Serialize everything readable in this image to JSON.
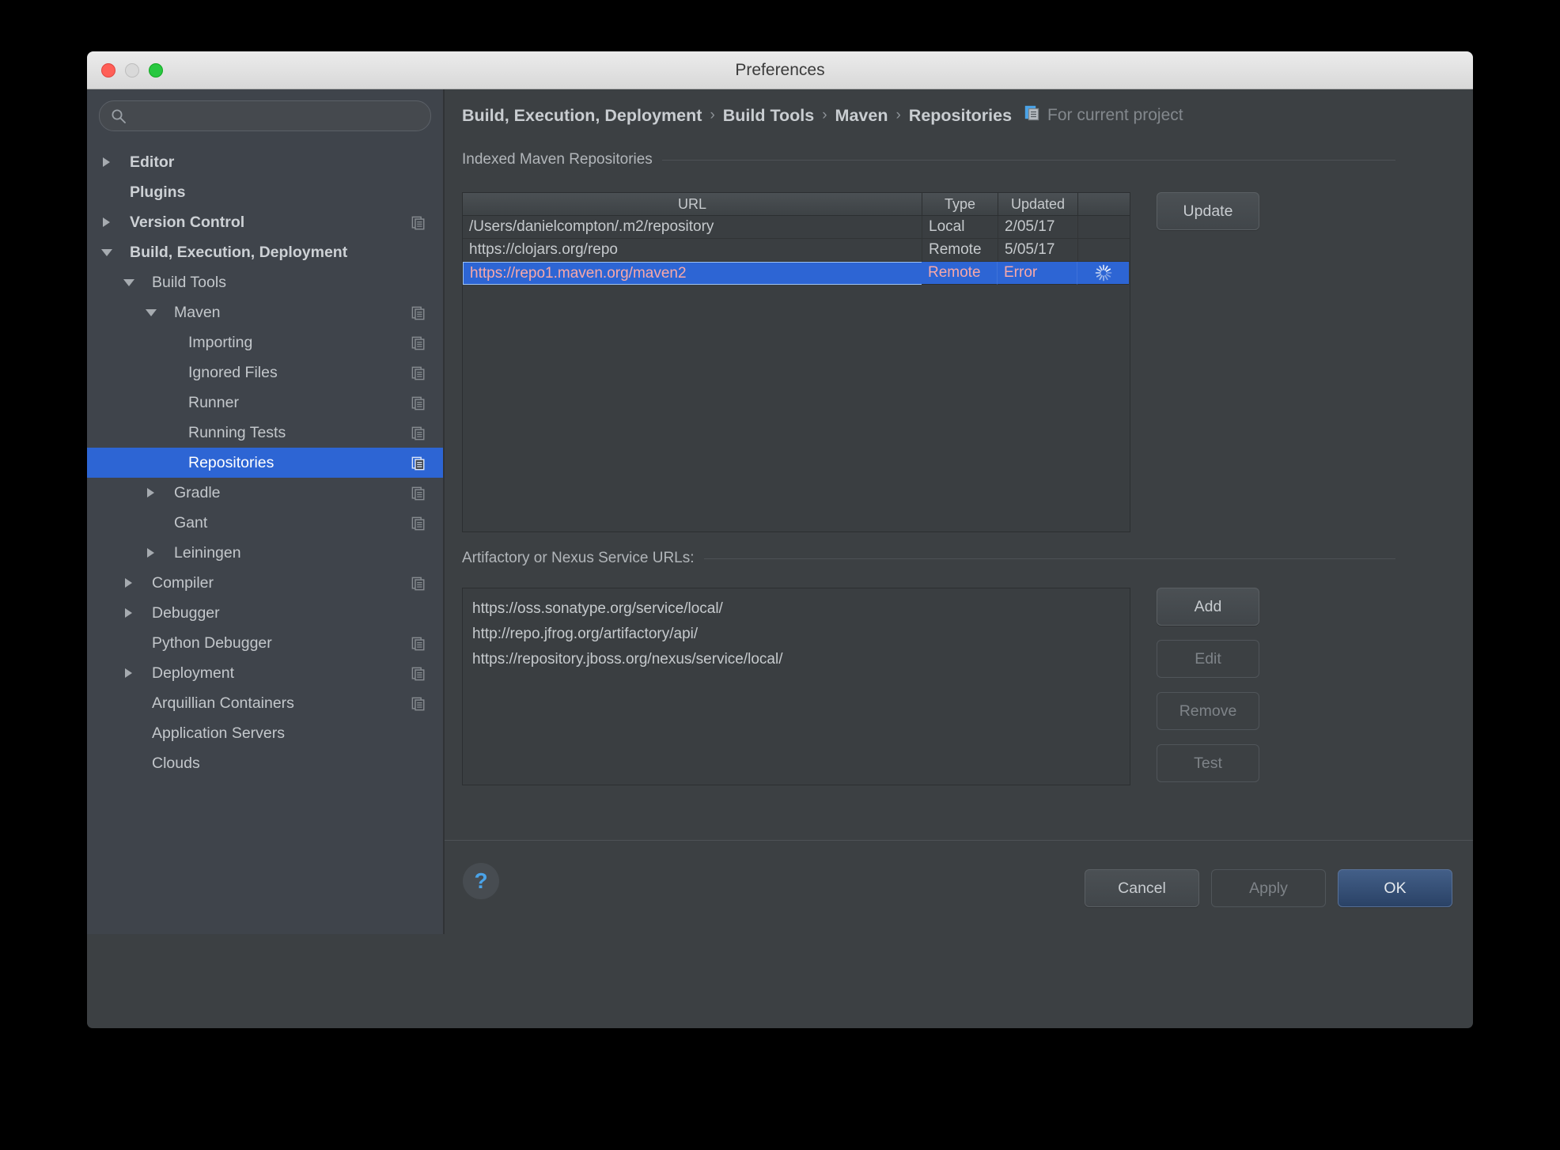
{
  "window": {
    "title": "Preferences",
    "traffic_lights": [
      "close-button",
      "minimize-button",
      "zoom-button"
    ]
  },
  "sidebar": {
    "search": {
      "value": "",
      "placeholder": ""
    },
    "items": [
      {
        "label": "Editor",
        "level": 0,
        "arrow": "right",
        "bold": true,
        "copy": false,
        "selected": false
      },
      {
        "label": "Plugins",
        "level": 0,
        "arrow": "none",
        "bold": true,
        "copy": false,
        "selected": false
      },
      {
        "label": "Version Control",
        "level": 0,
        "arrow": "right",
        "bold": true,
        "copy": true,
        "selected": false
      },
      {
        "label": "Build, Execution, Deployment",
        "level": 0,
        "arrow": "down",
        "bold": true,
        "copy": false,
        "selected": false
      },
      {
        "label": "Build Tools",
        "level": 1,
        "arrow": "down",
        "bold": false,
        "copy": false,
        "selected": false
      },
      {
        "label": "Maven",
        "level": 2,
        "arrow": "down",
        "bold": false,
        "copy": true,
        "selected": false
      },
      {
        "label": "Importing",
        "level": 3,
        "arrow": "none",
        "bold": false,
        "copy": true,
        "selected": false
      },
      {
        "label": "Ignored Files",
        "level": 3,
        "arrow": "none",
        "bold": false,
        "copy": true,
        "selected": false
      },
      {
        "label": "Runner",
        "level": 3,
        "arrow": "none",
        "bold": false,
        "copy": true,
        "selected": false
      },
      {
        "label": "Running Tests",
        "level": 3,
        "arrow": "none",
        "bold": false,
        "copy": true,
        "selected": false
      },
      {
        "label": "Repositories",
        "level": 3,
        "arrow": "none",
        "bold": false,
        "copy": true,
        "selected": true
      },
      {
        "label": "Gradle",
        "level": 2,
        "arrow": "right",
        "bold": false,
        "copy": true,
        "selected": false
      },
      {
        "label": "Gant",
        "level": 2,
        "arrow": "none",
        "bold": false,
        "copy": true,
        "selected": false
      },
      {
        "label": "Leiningen",
        "level": 2,
        "arrow": "right",
        "bold": false,
        "copy": false,
        "selected": false
      },
      {
        "label": "Compiler",
        "level": 1,
        "arrow": "right",
        "bold": false,
        "copy": true,
        "selected": false
      },
      {
        "label": "Debugger",
        "level": 1,
        "arrow": "right",
        "bold": false,
        "copy": false,
        "selected": false
      },
      {
        "label": "Python Debugger",
        "level": 1,
        "arrow": "none",
        "bold": false,
        "copy": true,
        "selected": false
      },
      {
        "label": "Deployment",
        "level": 1,
        "arrow": "right",
        "bold": false,
        "copy": true,
        "selected": false
      },
      {
        "label": "Arquillian Containers",
        "level": 1,
        "arrow": "none",
        "bold": false,
        "copy": true,
        "selected": false
      },
      {
        "label": "Application Servers",
        "level": 1,
        "arrow": "none",
        "bold": false,
        "copy": false,
        "selected": false
      },
      {
        "label": "Clouds",
        "level": 1,
        "arrow": "none",
        "bold": false,
        "copy": false,
        "selected": false
      }
    ]
  },
  "main": {
    "breadcrumb": {
      "parts": [
        "Build, Execution, Deployment",
        "Build Tools",
        "Maven",
        "Repositories"
      ],
      "separator": "›",
      "scope_label": "For current project"
    },
    "indexed_section": {
      "title": "Indexed Maven Repositories",
      "columns": [
        "URL",
        "Type",
        "Updated",
        ""
      ],
      "rows": [
        {
          "url": "/Users/danielcompton/.m2/repository",
          "type": "Local",
          "updated": "2/05/17",
          "status": "",
          "selected": false
        },
        {
          "url": "https://clojars.org/repo",
          "type": "Remote",
          "updated": "5/05/17",
          "status": "",
          "selected": false
        },
        {
          "url": "https://repo1.maven.org/maven2",
          "type": "Remote",
          "updated": "Error",
          "status": "loading-spinner",
          "selected": true
        }
      ],
      "update_button": "Update"
    },
    "service_urls_section": {
      "title": "Artifactory or Nexus Service URLs:",
      "urls": [
        "https://oss.sonatype.org/service/local/",
        "http://repo.jfrog.org/artifactory/api/",
        "https://repository.jboss.org/nexus/service/local/"
      ],
      "buttons": [
        {
          "label": "Add",
          "enabled": true
        },
        {
          "label": "Edit",
          "enabled": false
        },
        {
          "label": "Remove",
          "enabled": false
        },
        {
          "label": "Test",
          "enabled": false
        }
      ]
    }
  },
  "footer": {
    "help": "?",
    "cancel": "Cancel",
    "apply": "Apply",
    "ok": "OK"
  },
  "colors": {
    "accent_blue": "#2d65d4",
    "error_text": "#f7a8a8",
    "window_bg": "#3c4043",
    "sidebar_bg": "#3f444b",
    "help_blue": "#4aa3e8"
  }
}
